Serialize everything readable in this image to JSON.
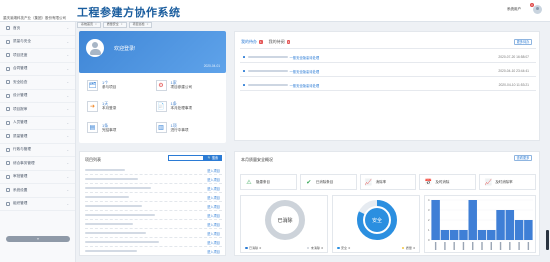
{
  "app": {
    "title": "工程参建方协作系统",
    "company": "重庆渝湘科技产业（集团）股份有限公司",
    "user_name": "系统用户",
    "user_badge": "3"
  },
  "tabs": [
    {
      "label": "系统首页"
    },
    {
      "label": "质量安全"
    },
    {
      "label": "项目巡检"
    }
  ],
  "sidebar": {
    "items": [
      {
        "label": "首页",
        "active": false
      },
      {
        "label": "质量与安全",
        "active": false
      },
      {
        "label": "项目进度",
        "active": false
      },
      {
        "label": "合同管理",
        "active": false
      },
      {
        "label": "安全检查",
        "active": false
      },
      {
        "label": "设计管理",
        "active": false
      },
      {
        "label": "项目报审",
        "active": false
      },
      {
        "label": "人员管理",
        "active": false
      },
      {
        "label": "质量管理",
        "active": false
      },
      {
        "label": "行政与管理",
        "active": false
      },
      {
        "label": "综合事务管理",
        "active": false
      },
      {
        "label": "审批管理",
        "active": false
      },
      {
        "label": "系统设置",
        "active": false
      },
      {
        "label": "组织管理",
        "active": false
      }
    ],
    "collapse_label": "«"
  },
  "welcome": {
    "greeting": "欢迎登录!",
    "date": "2020-04-01"
  },
  "quick": [
    {
      "num": "1个",
      "label": "参与项目",
      "icon": "🗂",
      "color": "#2b7bd5"
    },
    {
      "num": "1家",
      "label": "项目参建公司",
      "icon": "⚙",
      "color": "#e04848"
    },
    {
      "num": "1天",
      "label": "本月登录",
      "icon": "➜",
      "color": "#f08a2e"
    },
    {
      "num": "1条",
      "label": "本月处理事项",
      "icon": "📄",
      "color": "#2b7bd5"
    },
    {
      "num": "1条",
      "label": "完结事项",
      "icon": "▤",
      "color": "#2b7bd5"
    },
    {
      "num": "1项",
      "label": "进行中事项",
      "icon": "▥",
      "color": "#2b7bd5"
    }
  ],
  "todo": {
    "tab_pending": "我的待办",
    "tab_pending_count": "1",
    "tab_notice": "我的待阅",
    "tab_notice_count": "1",
    "more_label": "更多待办",
    "items": [
      {
        "text": "一般安全隐患待处理",
        "date": "2020-07-20 16:58:07"
      },
      {
        "text": "一般安全隐患待处理",
        "date": "2020-04-10 23:44:41"
      },
      {
        "text": "一般安全隐患待处理",
        "date": "2020-04-10 11:53:21"
      }
    ]
  },
  "project": {
    "title": "项目列表",
    "search_label": "搜索",
    "enter_label": "进入项目",
    "row_count": 10
  },
  "safety": {
    "title": "本月质量安全概况",
    "more_label": "查看更多",
    "stats": [
      {
        "label": "隐患条目",
        "icon": "⚠",
        "color": "#3aa85a"
      },
      {
        "label": "已消除条目",
        "icon": "✔",
        "color": "#3aa85a"
      },
      {
        "label": "消除率",
        "icon": "📈",
        "color": "#2b7bd5"
      },
      {
        "label": "及时消除",
        "icon": "📅",
        "color": "#f08a2e"
      },
      {
        "label": "及时消除率",
        "icon": "📈",
        "color": "#2b7bd5"
      }
    ],
    "ring1": {
      "label": "已消除",
      "value": 1.0,
      "color": "#cdd3da",
      "legend": [
        {
          "label": "已消除",
          "value": "0",
          "color": "#2b7bd5"
        },
        {
          "label": "未消除",
          "value": "0",
          "color": "#cdd3da"
        }
      ]
    },
    "ring2": {
      "label": "安全",
      "value": 0.82,
      "color": "#2b8fe0",
      "legend": [
        {
          "label": "安全",
          "value": "0",
          "color": "#2b8fe0"
        },
        {
          "label": "质量",
          "value": "0",
          "color": "#f2c744"
        }
      ]
    }
  },
  "chart_data": {
    "type": "bar",
    "values": [
      4,
      1,
      1,
      1,
      4,
      1,
      1,
      3,
      3,
      2,
      2
    ],
    "ylim": [
      0,
      4
    ]
  }
}
